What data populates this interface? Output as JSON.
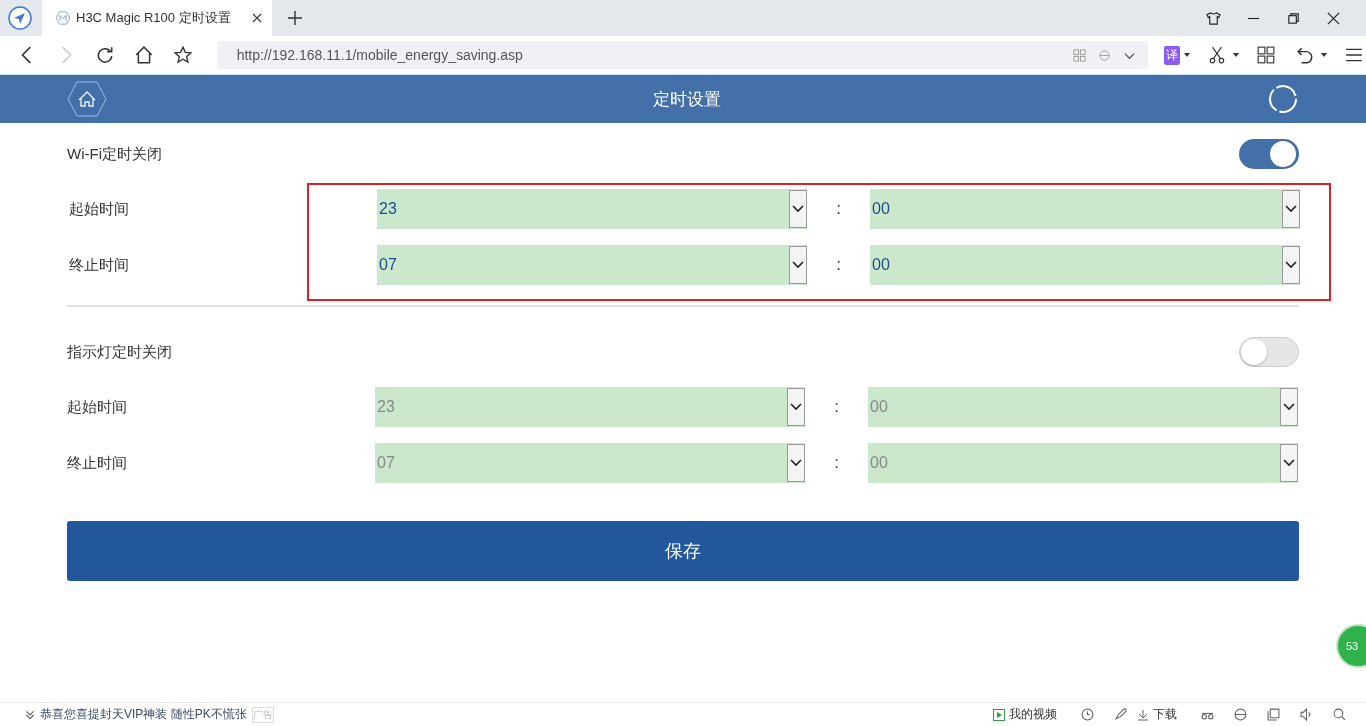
{
  "browser": {
    "tab_title": "H3C Magic R100 定时设置",
    "url": "http://192.168.11.1/mobile_energy_saving.asp",
    "translate_label": "译"
  },
  "header": {
    "title": "定时设置"
  },
  "sections": [
    {
      "title": "Wi-Fi定时关闭",
      "on": true,
      "highlighted": true,
      "rows": [
        {
          "label": "起始时间",
          "hour": "23",
          "separator": ":",
          "minute": "00"
        },
        {
          "label": "终止时间",
          "hour": "07",
          "separator": ":",
          "minute": "00"
        }
      ]
    },
    {
      "title": "指示灯定时关闭",
      "on": false,
      "highlighted": false,
      "rows": [
        {
          "label": "起始时间",
          "hour": "23",
          "separator": ":",
          "minute": "00"
        },
        {
          "label": "终止时间",
          "hour": "07",
          "separator": ":",
          "minute": "00"
        }
      ]
    }
  ],
  "save_button": "保存",
  "floating_badge": "53",
  "status_bar": {
    "ad_text": "恭喜您喜提封天VIP神装 随性PK不慌张",
    "ad_tag": "广告",
    "video_label": "我的视频",
    "download_label": "下载"
  }
}
